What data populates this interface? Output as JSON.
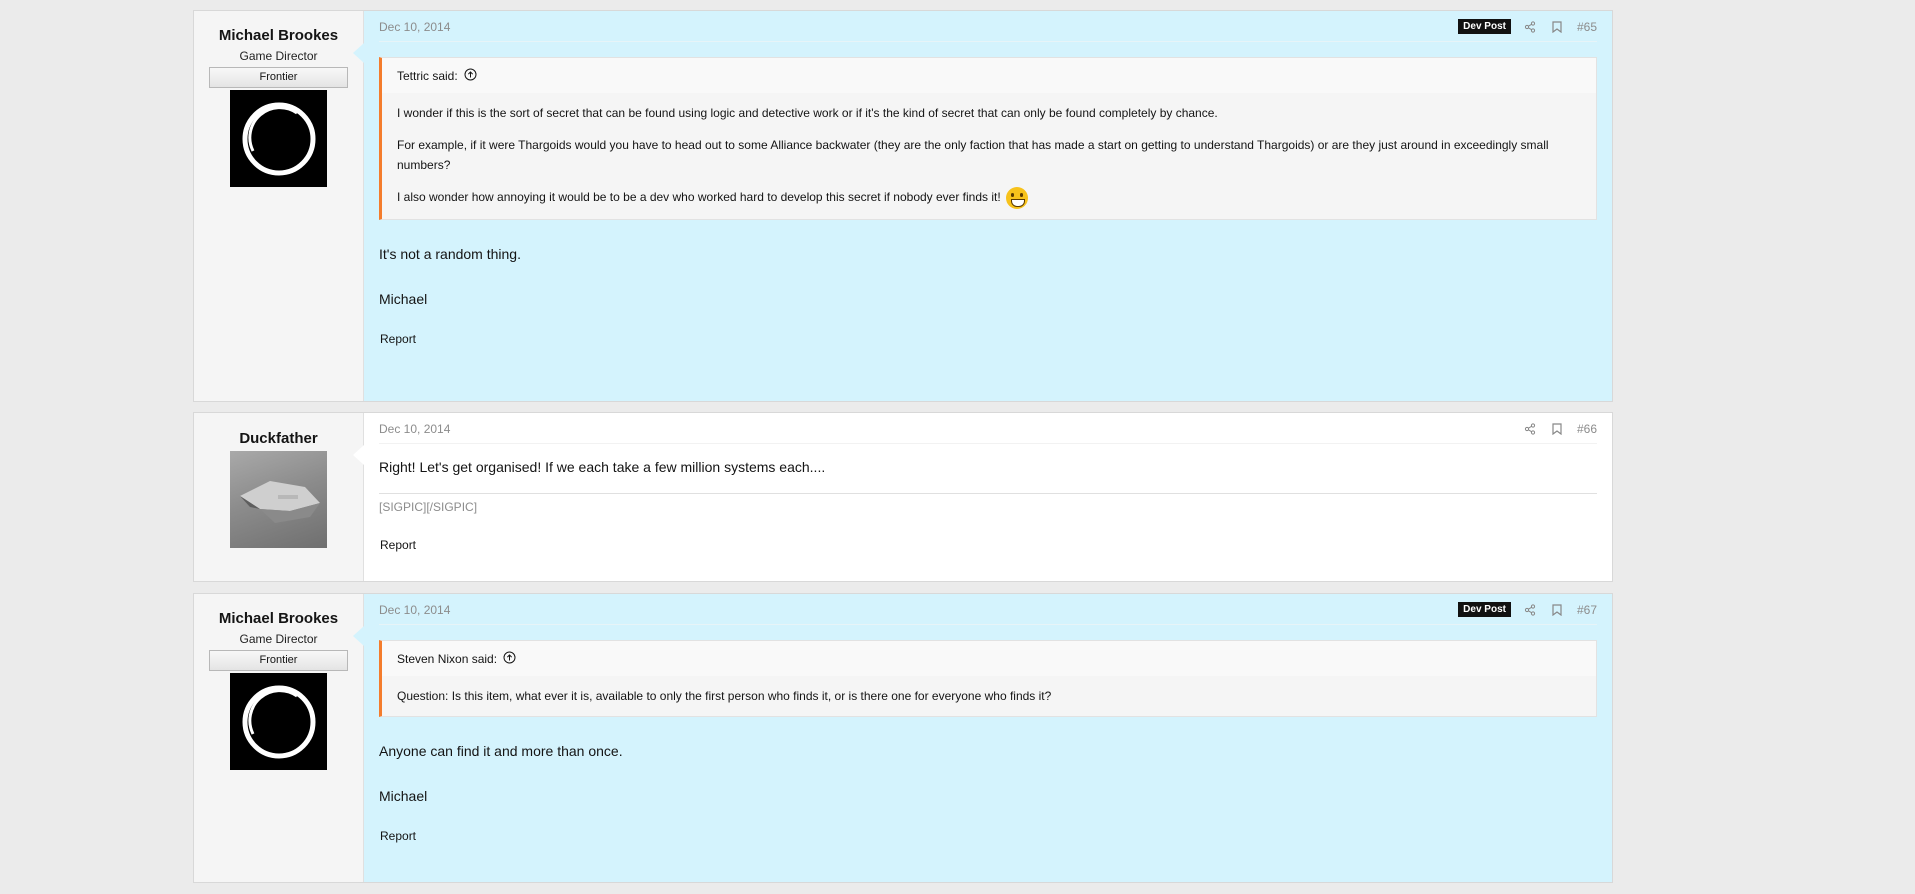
{
  "posts": [
    {
      "user": {
        "name": "Michael Brookes",
        "title": "Game Director",
        "banner": "Frontier",
        "avatar": "circle-logo"
      },
      "date": "Dec 10, 2014",
      "badge": "Dev Post",
      "number": "#65",
      "quote": {
        "author": "Tettric said:",
        "paragraphs": [
          "I wonder if this is the sort of secret that can be found using logic and detective work or if it's the kind of secret that can only be found completely by chance.",
          "For example, if it were Thargoids would you have to head out to some Alliance backwater (they are the only faction that has made a start on getting to understand Thargoids) or are they just around in exceedingly small numbers?",
          "I also wonder how annoying it would be to be a dev who worked hard to develop this secret if nobody ever finds it!"
        ]
      },
      "message": [
        "It's not a random thing.",
        "Michael"
      ],
      "report": "Report"
    },
    {
      "user": {
        "name": "Duckfather",
        "avatar": "ship-image"
      },
      "date": "Dec 10, 2014",
      "number": "#66",
      "message": [
        "Right! Let's get organised! If we each take a few million systems each...."
      ],
      "signature": "[SIGPIC][/SIGPIC]",
      "report": "Report"
    },
    {
      "user": {
        "name": "Michael Brookes",
        "title": "Game Director",
        "banner": "Frontier",
        "avatar": "circle-logo"
      },
      "date": "Dec 10, 2014",
      "badge": "Dev Post",
      "number": "#67",
      "quote": {
        "author": "Steven Nixon said:",
        "paragraphs": [
          "Question: Is this item, what ever it is, available to only the first person who finds it, or is there one for everyone who finds it?"
        ]
      },
      "message": [
        "Anyone can find it and more than once.",
        "Michael"
      ],
      "report": "Report"
    }
  ],
  "colors": {
    "dev_bg": "#d4f3fd",
    "quote_border": "#f47c2c",
    "badge_bg": "#111111"
  }
}
